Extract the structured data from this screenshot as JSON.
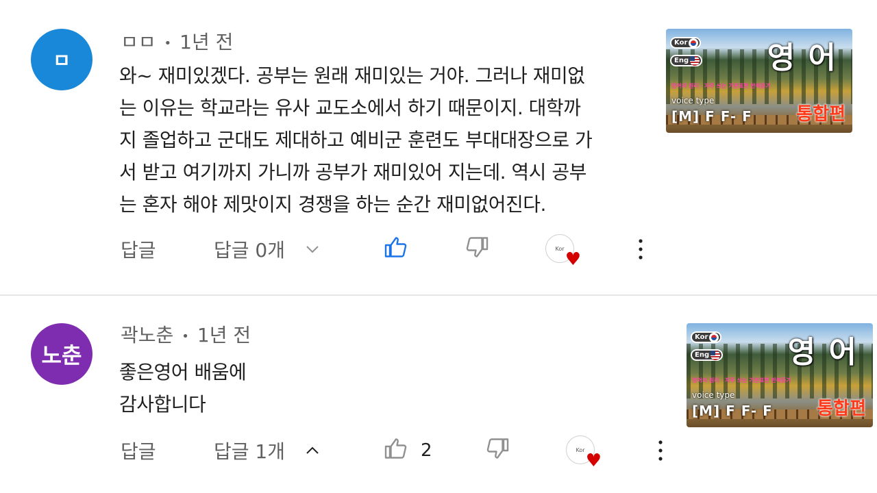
{
  "comments": [
    {
      "author": "ㅁㅁ",
      "avatar_text": "ㅁ",
      "avatar_color": "#1a88d8",
      "time": "1년 전",
      "separator": "•",
      "lines": [
        "와~ 재미있겠다. 공부는 원래 재미있는 거야. 그러나 재미없",
        "는 이유는 학교라는 유사 교도소에서 하기 때문이지. 대학까",
        "지 졸업하고 군대도 제대하고 예비군 훈련도 부대대장으로 가",
        "서 받고 여기까지 가니까 공부가 재미있어 지는데. 역시 공부",
        "는 혼자 해야 제맛이지 경쟁을 하는 순간 재미없어진다."
      ],
      "reply_label": "답글",
      "replies_label": "답글 0개",
      "replies_state": "collapsed",
      "like_count": "",
      "liked": true,
      "heart_icon": "creator-heart-icon"
    },
    {
      "author": "곽노춘",
      "avatar_text": "노춘",
      "avatar_color": "#7f2db0",
      "time": "1년 전",
      "separator": "•",
      "lines": [
        "좋은영어 배움에",
        "감사합니다"
      ],
      "reply_label": "답글",
      "replies_label": "답글 1개",
      "replies_state": "expanded",
      "like_count": "2",
      "liked": false,
      "heart_icon": "creator-heart-icon"
    }
  ],
  "thumbnail": {
    "title": "영 어",
    "kor_tag": "Kor",
    "eng_tag": "Eng",
    "pink_text": "영어의 원리 · 자주 쓰는 기본표현 반복듣기",
    "voice_label": "voice type",
    "voice_value": "[M] F F- F",
    "badge": "통합편"
  },
  "colors": {
    "like_active": "#1a73e8",
    "icon_gray": "#909090",
    "heart": "#d40000"
  }
}
